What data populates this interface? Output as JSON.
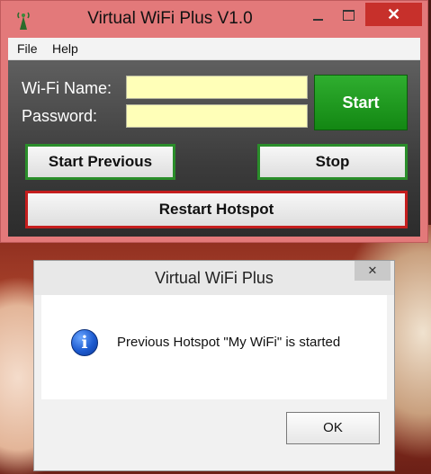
{
  "window": {
    "title": "Virtual WiFi Plus V1.0",
    "close_glyph": "✕"
  },
  "menu": {
    "items": [
      {
        "label": "File"
      },
      {
        "label": "Help"
      }
    ]
  },
  "form": {
    "wifi_name_label": "Wi-Fi Name:",
    "password_label": "Password:",
    "wifi_name_value": "",
    "password_value": ""
  },
  "buttons": {
    "start": "Start",
    "start_previous": "Start Previous",
    "stop": "Stop",
    "restart_hotspot": "Restart Hotspot"
  },
  "dialog": {
    "title": "Virtual WiFi Plus",
    "close_glyph": "✕",
    "icon": "info-icon",
    "icon_glyph": "i",
    "message": "Previous Hotspot \"My WiFi\" is started",
    "ok_label": "OK"
  },
  "colors": {
    "window_frame": "#e3797a",
    "start_button": "#1f9a1f",
    "input_background": "#ffffb8",
    "close_button": "#c7302b"
  }
}
